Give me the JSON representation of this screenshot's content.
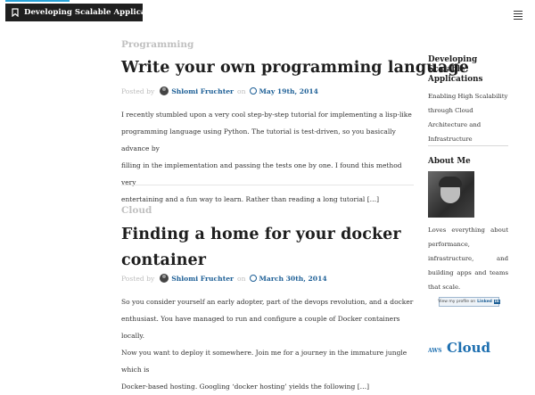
{
  "header": {
    "site_title": "Developing Scalable Applications"
  },
  "posts": [
    {
      "category": "Programming",
      "title": "Write your own programming language",
      "posted_by": "Posted by",
      "author": "Shlomi Fruchter",
      "on": "on",
      "date": "May 19th, 2014",
      "excerpt_lines": [
        "I recently stumbled upon a very cool step-by-step tutorial for implementing a lisp-like",
        "programming language using Python. The tutorial is test-driven, so you basically advance by",
        "filling in the implementation and passing the tests one by one. I found this method very",
        "entertaining and a fun way to learn. Rather than reading a long tutorial […]"
      ]
    },
    {
      "category": "Cloud",
      "title_lines": [
        "Finding a home for your docker",
        "container"
      ],
      "posted_by": "Posted by",
      "author": "Shlomi Fruchter",
      "on": "on",
      "date": "March 30th, 2014",
      "excerpt_lines": [
        "So you consider yourself an early adopter, part of the devops revolution, and a docker",
        "enthusiast. You have managed to run and configure a couple of Docker containers locally.",
        "Now you want to deploy it somewhere. Join me for a journey in the immature jungle which is",
        "Docker-based hosting. Googling ‘docker hosting’ yields the following […]"
      ]
    }
  ],
  "sidebar": {
    "blog_title_lines": [
      "Developing",
      "Scalable",
      "Applications"
    ],
    "tagline_lines": [
      "Enabling High Scalability",
      "through Cloud",
      "Architecture and",
      "Infrastructure"
    ],
    "about_title": "About Me",
    "about_lines": [
      "Loves everything about",
      "performance,",
      "infrastructure, and",
      "building apps and teams",
      "that scale."
    ],
    "linkedin_text": "View my profile on",
    "linkedin_brand": "Linked",
    "linkedin_in": "in",
    "tags": [
      "AWS",
      "Cloud"
    ]
  }
}
